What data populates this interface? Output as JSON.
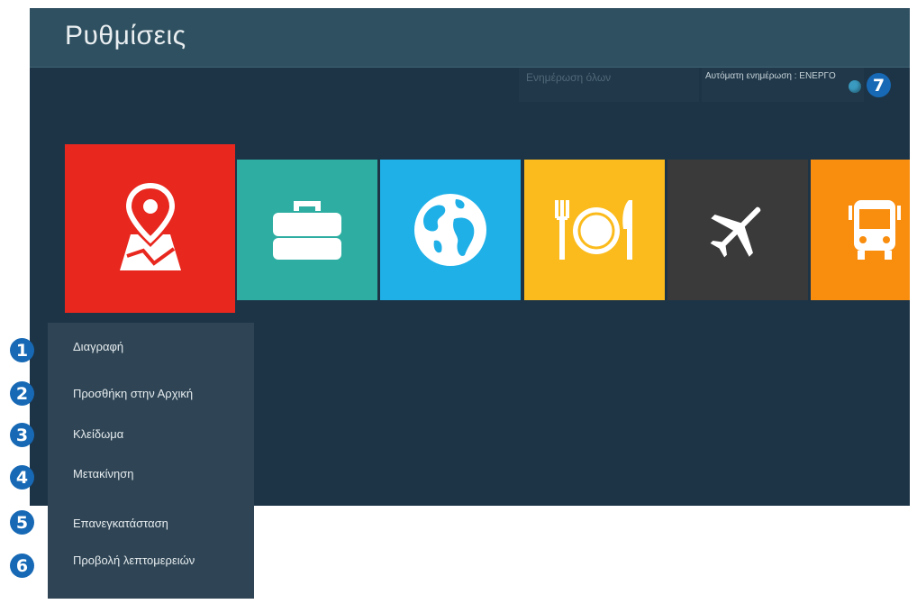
{
  "header": {
    "title": "Ρυθμίσεις"
  },
  "toolbar": {
    "update_all_label": "Ενημέρωση όλων",
    "auto_update_label": "Αυτόματη ενημέρωση : ΕΝΕΡΓΟ"
  },
  "tiles": [
    {
      "icon": "map-pin-icon",
      "color": "#e8271e",
      "focused": true
    },
    {
      "icon": "briefcase-icon",
      "color": "#2eaea2"
    },
    {
      "icon": "globe-icon",
      "color": "#1fb0e8"
    },
    {
      "icon": "fork-plate-knife-icon",
      "color": "#fbbb1c"
    },
    {
      "icon": "airplane-icon",
      "color": "#3a3a3a"
    },
    {
      "icon": "bus-icon",
      "color": "#f98d0e"
    }
  ],
  "context_menu": {
    "items": [
      {
        "label": "Διαγραφή"
      },
      {
        "label": "Προσθήκη στην Αρχική"
      },
      {
        "label": "Κλείδωμα"
      },
      {
        "label": "Μετακίνηση"
      },
      {
        "label": "Επανεγκατάσταση"
      },
      {
        "label": "Προβολή λεπτομερειών"
      }
    ]
  },
  "callouts": [
    "1",
    "2",
    "3",
    "4",
    "5",
    "6",
    "7"
  ],
  "colors": {
    "callout": "#1769b5",
    "background": "#1d3447",
    "header": "#2f5060",
    "menu": "#2f4555"
  }
}
